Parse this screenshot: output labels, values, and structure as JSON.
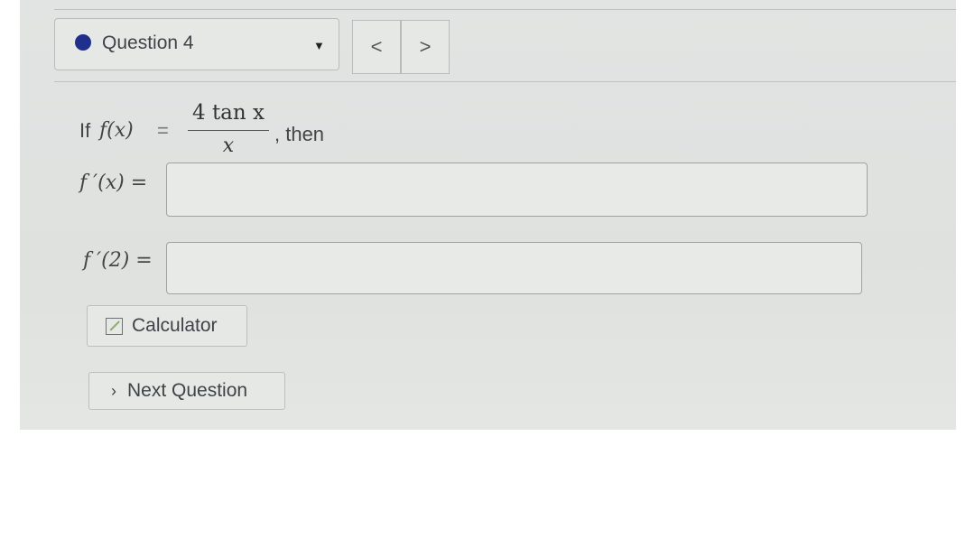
{
  "question_selector": {
    "label": "Question 4"
  },
  "nav": {
    "prev": "<",
    "next": ">"
  },
  "problem": {
    "prefix": "If",
    "fx": "f(x)",
    "equals": "=",
    "numerator": "4 tan x",
    "denominator": "x",
    "suffix": ", then"
  },
  "answers": [
    {
      "label": "f ′(x) =",
      "value": ""
    },
    {
      "label": "f ′(2) =",
      "value": ""
    }
  ],
  "buttons": {
    "calculator": "Calculator",
    "next_question": "Next Question"
  },
  "colors": {
    "status_dot": "#1f2f8c"
  }
}
